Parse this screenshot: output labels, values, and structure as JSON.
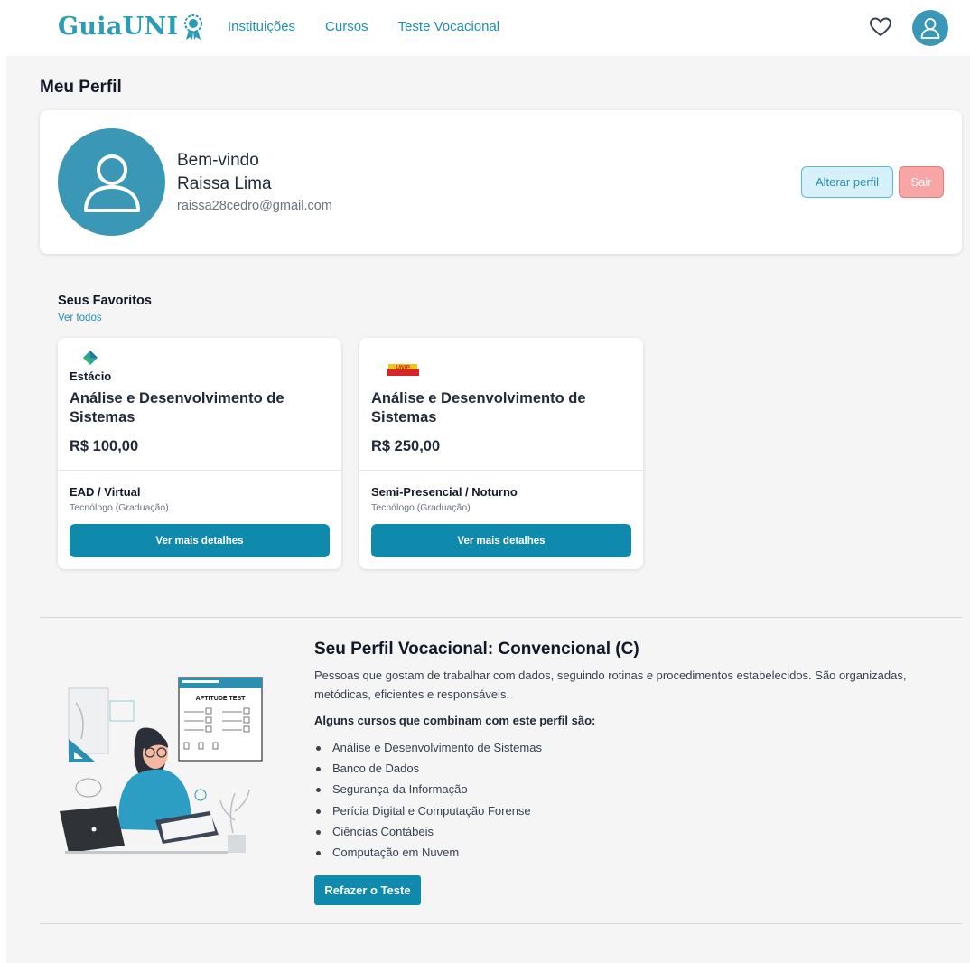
{
  "header": {
    "logo_text": "GuiaUNI",
    "nav": [
      "Instituições",
      "Cursos",
      "Teste Vocacional"
    ]
  },
  "page_title": "Meu Perfil",
  "profile": {
    "welcome": "Bem-vindo",
    "name": "Raissa Lima",
    "email": "raissa28cedro@gmail.com",
    "edit_label": "Alterar perfil",
    "logout_label": "Sair"
  },
  "favorites": {
    "title": "Seus Favoritos",
    "see_all": "Ver todos",
    "cards": [
      {
        "institution": "Estácio",
        "course": "Análise e Desenvolvimento de Sistemas",
        "price": "R$ 100,00",
        "modality": "EAD / Virtual",
        "degree": "Tecnólogo (Graduação)",
        "button": "Ver mais detalhes"
      },
      {
        "institution": "UNIP",
        "course": "Análise e Desenvolvimento de Sistemas",
        "price": "R$ 250,00",
        "modality": "Semi-Presencial / Noturno",
        "degree": "Tecnólogo (Graduação)",
        "button": "Ver mais detalhes"
      }
    ]
  },
  "vocational": {
    "title": "Seu Perfil Vocacional: Convencional (C)",
    "description": "Pessoas que gostam de trabalhar com dados, seguindo rotinas e procedimentos estabelecidos. São organizadas, metódicas, eficientes e responsáveis.",
    "subtitle": "Alguns cursos que combinam com este perfil são:",
    "courses": [
      "Análise e Desenvolvimento de Sistemas",
      "Banco de Dados",
      "Segurança da Informação",
      "Perícia Digital e Computação Forense",
      "Ciências Contábeis",
      "Computação em Nuvem"
    ],
    "illustration_label": "APTITUDE TEST",
    "redo_label": "Refazer o Teste"
  },
  "colors": {
    "brand": "#2a9cb6",
    "primary_button": "#0f8aac",
    "avatar": "#3a97b5",
    "logout": "#f7a5a5"
  }
}
